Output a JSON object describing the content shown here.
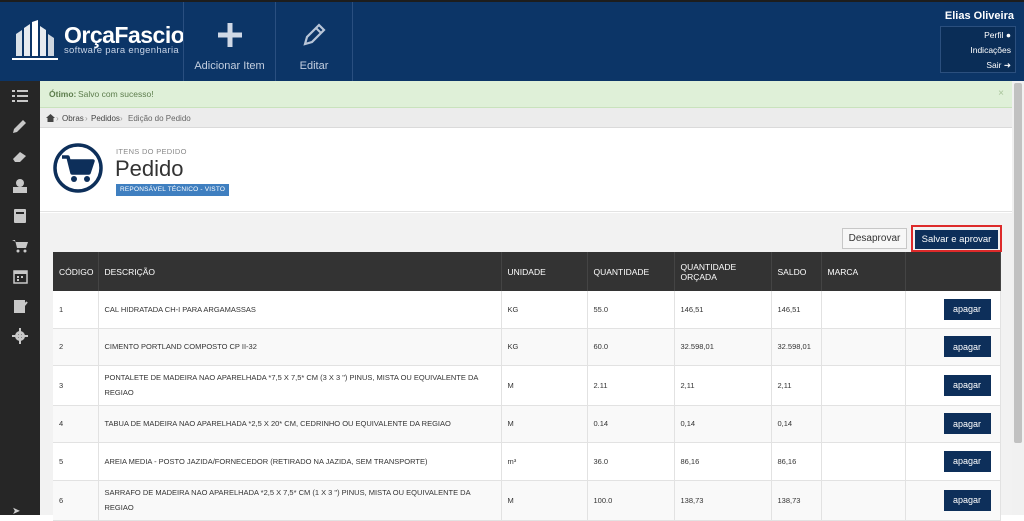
{
  "brand": {
    "name": "OrçaFascio",
    "tagline": "software para engenharia",
    "color": "#0c3567"
  },
  "toolbar": {
    "add_label": "Adicionar Item",
    "edit_label": "Editar"
  },
  "user": {
    "name": "Elias Oliveira",
    "menu": [
      "Perfil",
      "Indicações",
      "Sair"
    ]
  },
  "sidebar": {
    "icons": [
      "list-icon",
      "pencil-icon",
      "eraser-icon",
      "money-icon",
      "book-icon",
      "cart-icon",
      "calendar-icon",
      "clipboard-icon",
      "gear-icon"
    ]
  },
  "alert": {
    "title": "Ótimo:",
    "message": "Salvo com sucesso!",
    "close": "×"
  },
  "breadcrumb": {
    "items": [
      "Obras",
      "Pedidos",
      "Edição do Pedido"
    ]
  },
  "page": {
    "subtitle": "ITENS DO PEDIDO",
    "title": "Pedido",
    "badge": "REPONSÁVEL TÉCNICO - VISTO"
  },
  "actions": {
    "disapprove": "Desaprovar",
    "save_approve": "Salvar e aprovar"
  },
  "table": {
    "headers": [
      "CÓDIGO",
      "DESCRIÇÃO",
      "UNIDADE",
      "QUANTIDADE",
      "QUANTIDADE ORÇADA",
      "SALDO",
      "MARCA",
      ""
    ],
    "delete_label": "apagar",
    "rows": [
      {
        "code": "1",
        "desc": "CAL HIDRATADA CH-I PARA ARGAMASSAS",
        "unit": "KG",
        "qty": "55.0",
        "budget": "146,51",
        "balance": "146,51",
        "brand": ""
      },
      {
        "code": "2",
        "desc": "CIMENTO PORTLAND COMPOSTO CP II-32",
        "unit": "KG",
        "qty": "60.0",
        "budget": "32.598,01",
        "balance": "32.598,01",
        "brand": ""
      },
      {
        "code": "3",
        "desc": "PONTALETE DE MADEIRA NAO APARELHADA *7,5 X 7,5* CM (3 X 3 \") PINUS, MISTA OU EQUIVALENTE DA REGIAO",
        "unit": "M",
        "qty": "2.11",
        "budget": "2,11",
        "balance": "2,11",
        "brand": ""
      },
      {
        "code": "4",
        "desc": "TABUA DE MADEIRA NAO APARELHADA *2,5 X 20* CM, CEDRINHO OU EQUIVALENTE DA REGIAO",
        "unit": "M",
        "qty": "0.14",
        "budget": "0,14",
        "balance": "0,14",
        "brand": ""
      },
      {
        "code": "5",
        "desc": "AREIA MEDIA - POSTO JAZIDA/FORNECEDOR (RETIRADO NA JAZIDA, SEM TRANSPORTE)",
        "unit": "m³",
        "qty": "36.0",
        "budget": "86,16",
        "balance": "86,16",
        "brand": ""
      },
      {
        "code": "6",
        "desc": "SARRAFO DE MADEIRA NAO APARELHADA *2,5 X 7,5* CM (1 X 3 \") PINUS, MISTA OU EQUIVALENTE DA REGIAO",
        "unit": "M",
        "qty": "100.0",
        "budget": "138,73",
        "balance": "138,73",
        "brand": ""
      }
    ]
  },
  "colors": {
    "navy": "#0d2f5a",
    "highlight": "#dd2a2a",
    "success_bg": "#dff0d8"
  }
}
